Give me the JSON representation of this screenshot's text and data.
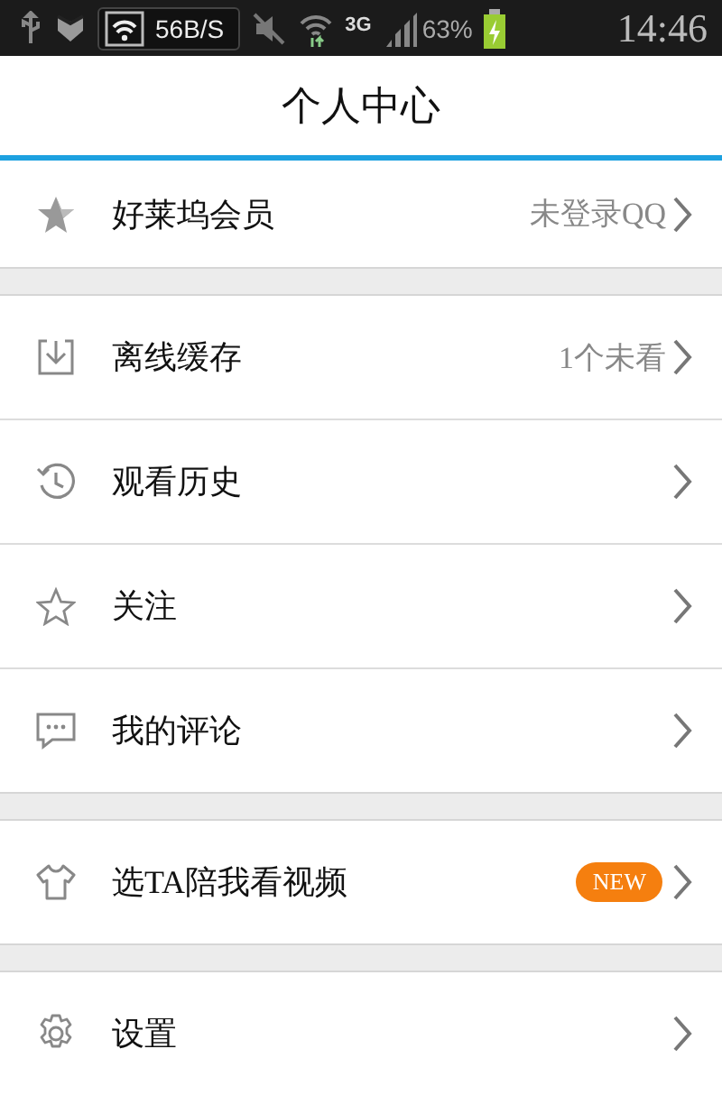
{
  "status_bar": {
    "speed": "56B/S",
    "network": "3G",
    "battery": "63%",
    "time": "14:46"
  },
  "header": {
    "title": "个人中心"
  },
  "groups": [
    [
      {
        "kind": "star",
        "label": "好莱坞会员",
        "detail": "未登录QQ"
      }
    ],
    [
      {
        "kind": "download",
        "label": "离线缓存",
        "detail": "1个未看"
      },
      {
        "kind": "history",
        "label": "观看历史"
      },
      {
        "kind": "star-outline",
        "label": "关注"
      },
      {
        "kind": "comment",
        "label": "我的评论"
      }
    ],
    [
      {
        "kind": "shirt",
        "label": "选TA陪我看视频",
        "badge": "NEW"
      }
    ],
    [
      {
        "kind": "gear",
        "label": "设置"
      }
    ]
  ]
}
